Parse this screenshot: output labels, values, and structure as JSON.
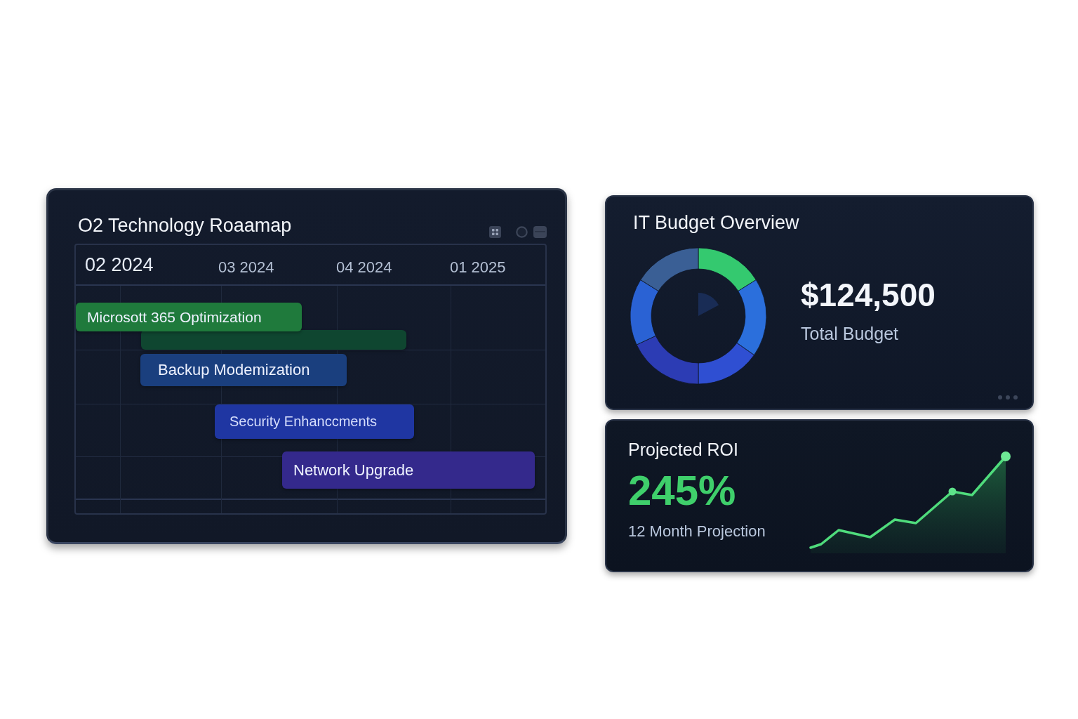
{
  "roadmap": {
    "title": "O2 Technology Roaamap",
    "quarters": [
      {
        "label": "02 2024",
        "current": true
      },
      {
        "label": "03 2024",
        "current": false
      },
      {
        "label": "04 2024",
        "current": false
      },
      {
        "label": "01 2025",
        "current": false
      }
    ],
    "tasks": [
      {
        "label": "Microsott 365 Optimization",
        "color": "#1f7a3c"
      },
      {
        "color": "#0f4630"
      },
      {
        "label": "Backup Modemization",
        "color": "#1a3f7e"
      },
      {
        "label": "Security Enhanccments",
        "color": "#1f36a2"
      },
      {
        "label": "Network Upgrade",
        "color": "#34298c"
      }
    ]
  },
  "budget": {
    "title": "IT Budget Overview",
    "amount": "$124,500",
    "caption": "Total Budget"
  },
  "roi": {
    "title": "Projected ROI",
    "value": "245%",
    "caption": "12 Month Projection"
  }
}
